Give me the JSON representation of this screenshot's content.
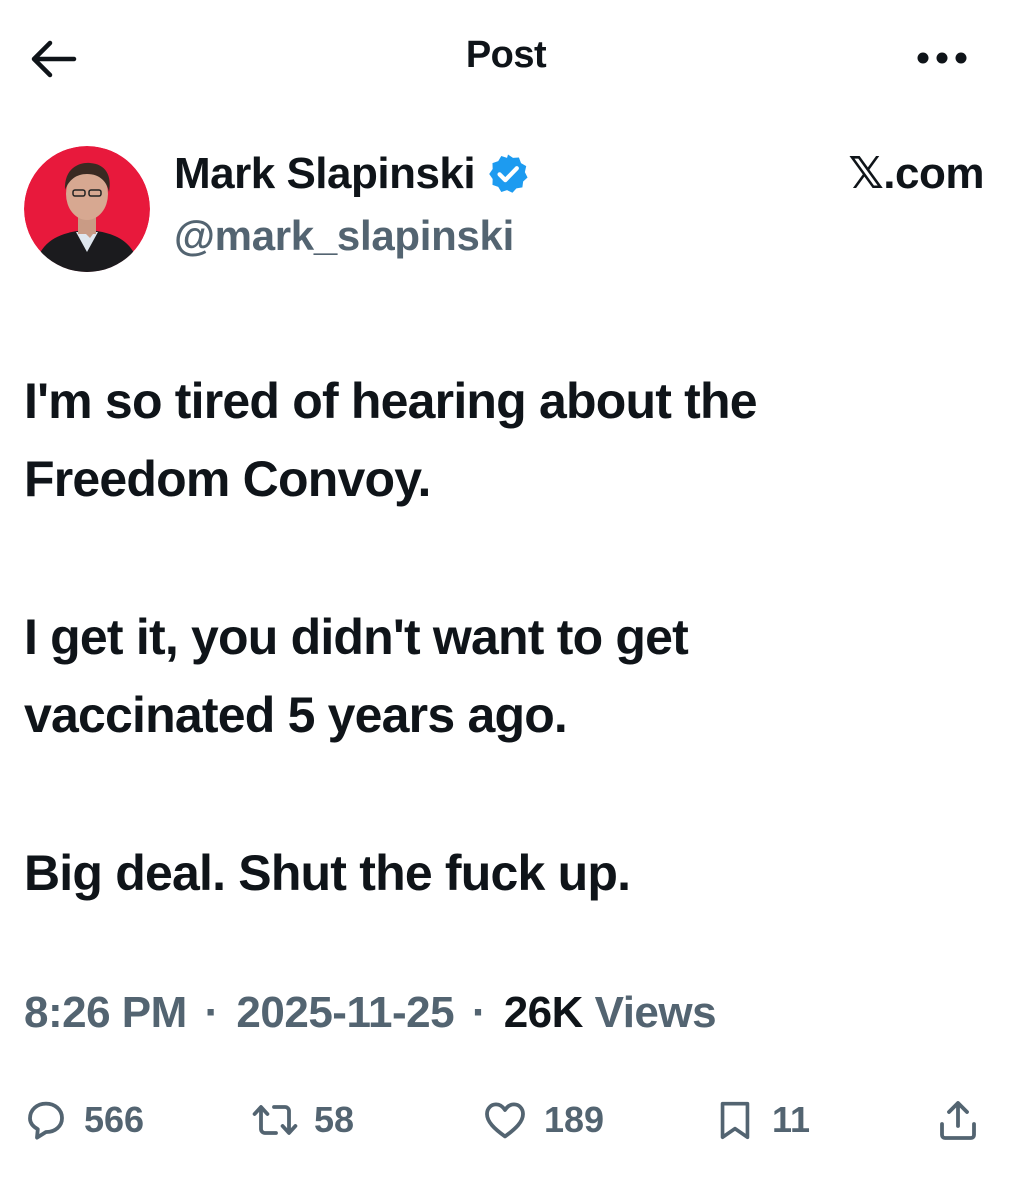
{
  "header": {
    "title": "Post",
    "back_icon": "arrow-left-icon",
    "more_icon": "more-horizontal-icon"
  },
  "author": {
    "display_name": "Mark Slapinski",
    "handle": "@mark_slapinski",
    "verified": true,
    "verified_color": "#1d9bf0"
  },
  "brand": "𝕏.com",
  "post": {
    "paragraphs": [
      "I'm so tired of hearing about the\nFreedom Convoy.",
      "I get it, you didn't want to get\nvaccinated 5 years ago.",
      "Big deal. Shut the fuck up."
    ]
  },
  "meta": {
    "time": "8:26 PM",
    "separator": "·",
    "date": "2025-11-25",
    "views_count": "26K",
    "views_label": "Views"
  },
  "actions": {
    "replies": "566",
    "reposts": "58",
    "likes": "189",
    "bookmarks": "11"
  },
  "colors": {
    "text": "#0f1419",
    "secondary": "#536471",
    "avatar_background": "#e8193c"
  }
}
